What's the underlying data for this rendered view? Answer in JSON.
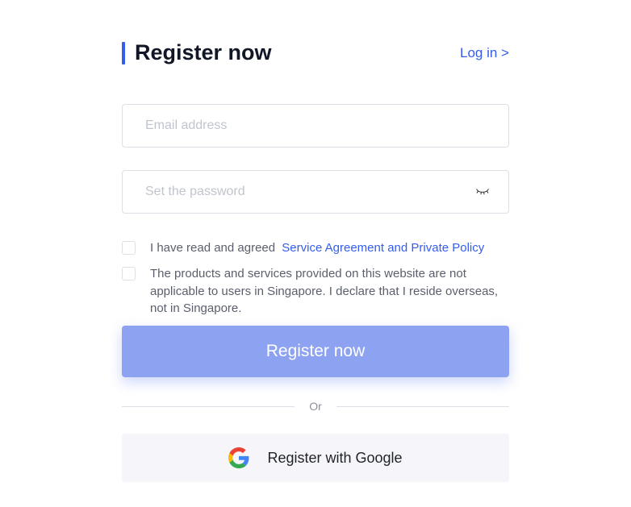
{
  "header": {
    "title": "Register now",
    "login_link": "Log in >"
  },
  "form": {
    "email_placeholder": "Email address",
    "password_placeholder": "Set the password"
  },
  "checkboxes": {
    "agreement_prefix": "I have read and agreed",
    "agreement_link": "Service Agreement and Private Policy",
    "singapore_declaration": "The products and services provided on this website are not applicable to users in Singapore. I declare that I reside overseas, not in Singapore."
  },
  "buttons": {
    "register": "Register now",
    "google": "Register with Google"
  },
  "divider": {
    "or": "Or"
  }
}
